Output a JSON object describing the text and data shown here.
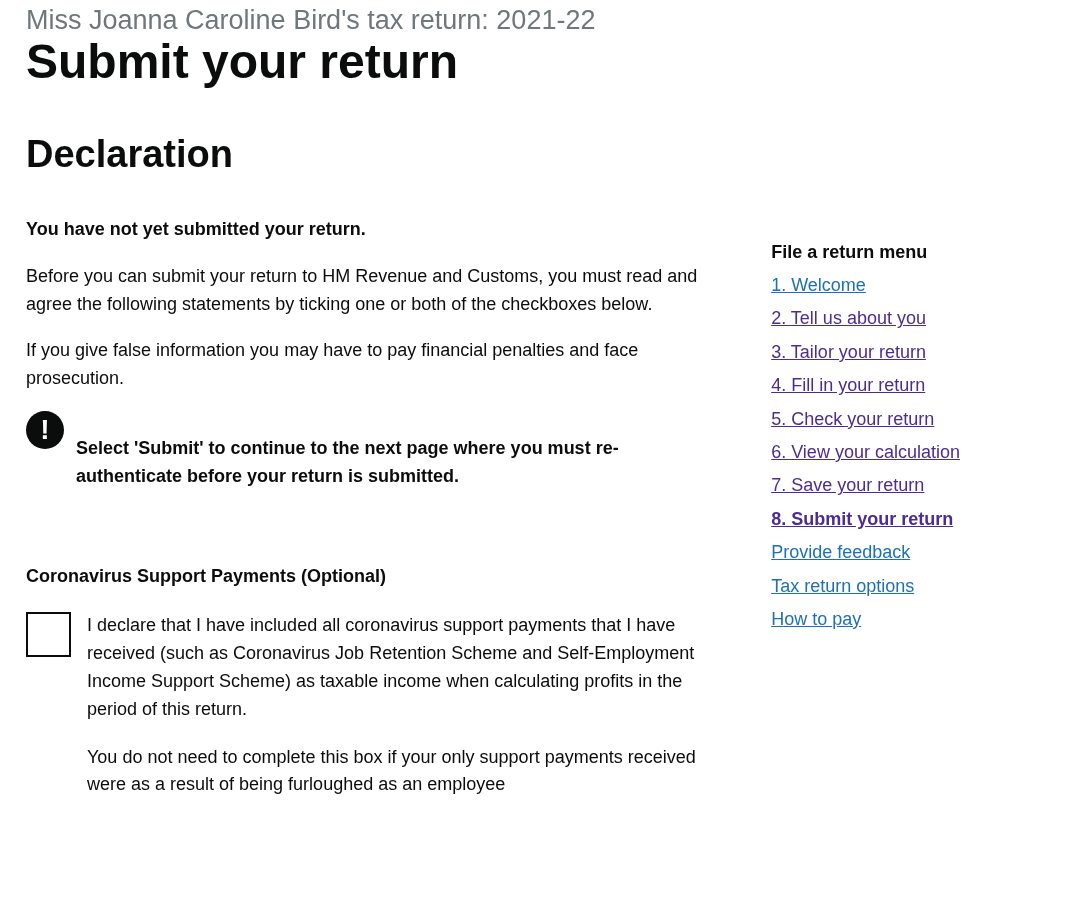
{
  "caption": "Miss Joanna Caroline Bird's tax return:  2021-22",
  "title": "Submit your return",
  "declaration": {
    "heading": "Declaration",
    "status": "You have not yet submitted your return.",
    "paragraphs": [
      "Before you can submit your return to HM Revenue and Customs, you must read and agree the following statements by ticking one or both of the checkboxes below.",
      "If you give false information you may have to pay financial penalties and face prosecution."
    ],
    "warning": {
      "icon": "!",
      "text": "Select 'Submit' to continue to the next page where you must re-authenticate before your return is submitted."
    },
    "coronavirus": {
      "heading": "Coronavirus Support Payments (Optional)",
      "checked": false,
      "label": "I declare that I have included all coronavirus support payments that I have received (such as Coronavirus Job Retention Scheme and Self-Employment Income Support Scheme) as taxable income when calculating profits in the period of this return.",
      "hint": "You do not need to complete this box if your only support payments received were as a result of being furloughed as an employee"
    }
  },
  "menu": {
    "heading": "File a return menu",
    "items": [
      {
        "label": "1. Welcome",
        "visited": false,
        "selected": false
      },
      {
        "label": "2. Tell us about you",
        "visited": true,
        "selected": false
      },
      {
        "label": "3. Tailor your return",
        "visited": true,
        "selected": false
      },
      {
        "label": "4. Fill in your return",
        "visited": true,
        "selected": false
      },
      {
        "label": "5. Check your return",
        "visited": true,
        "selected": false
      },
      {
        "label": "6. View your calculation",
        "visited": true,
        "selected": false
      },
      {
        "label": "7. Save your return",
        "visited": true,
        "selected": false
      },
      {
        "label": "8. Submit your return",
        "visited": true,
        "selected": true
      },
      {
        "label": "Provide feedback",
        "visited": false,
        "selected": false
      },
      {
        "label": "Tax return options",
        "visited": false,
        "selected": false
      },
      {
        "label": "How to pay",
        "visited": false,
        "selected": false
      }
    ]
  }
}
